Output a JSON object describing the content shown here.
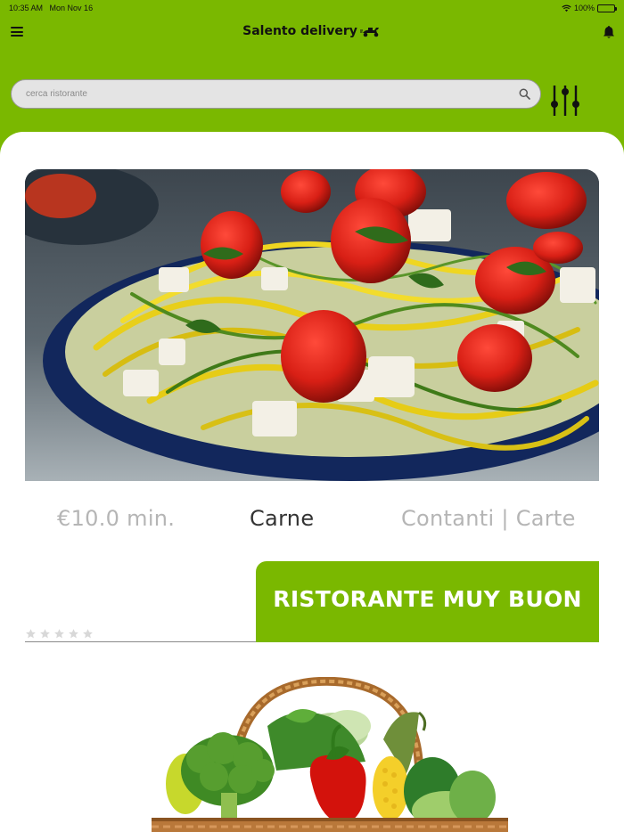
{
  "status_bar": {
    "time": "10:35 AM",
    "date": "Mon Nov 16",
    "battery": "100%"
  },
  "header": {
    "title": "Salento delivery",
    "menu_icon": "hamburger-menu-icon",
    "logo_icon": "scooter-icon",
    "notification_icon": "bell-icon"
  },
  "search": {
    "placeholder": "cerca ristorante",
    "value": "",
    "icon": "search-icon",
    "filter_icon": "sliders-icon"
  },
  "restaurant": {
    "min_order": "€10.0 min.",
    "category": "Carne",
    "payment": "Contanti | Carte",
    "name": "RISTORANTE MUY BUON",
    "rating_out_of": 5,
    "rating": 0
  },
  "colors": {
    "brand_green": "#7ab800",
    "card_background": "#ffffff",
    "muted_text": "#b5b5b5",
    "primary_text": "#333333"
  }
}
